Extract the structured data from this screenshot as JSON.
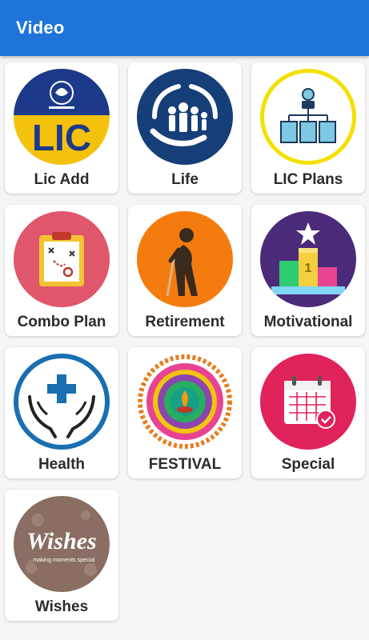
{
  "appbar": {
    "title": "Video",
    "color": "#1e74d9"
  },
  "categories": [
    {
      "label": "Lic Add",
      "icon": "lic-logo-icon"
    },
    {
      "label": "Life",
      "icon": "family-protection-icon"
    },
    {
      "label": "LIC Plans",
      "icon": "org-chart-icon"
    },
    {
      "label": "Combo Plan",
      "icon": "strategy-clipboard-icon"
    },
    {
      "label": "Retirement",
      "icon": "elderly-person-icon"
    },
    {
      "label": "Motivational",
      "icon": "podium-star-icon"
    },
    {
      "label": "Health",
      "icon": "hands-cross-icon"
    },
    {
      "label": "FESTIVAL",
      "icon": "rangoli-icon"
    },
    {
      "label": "Special",
      "icon": "calendar-check-icon"
    },
    {
      "label": "Wishes",
      "icon": "wishes-badge-icon"
    }
  ],
  "lic_logo_text": "LIC",
  "wishes_logo": {
    "title": "Wishes",
    "tagline": "...making moments special"
  }
}
